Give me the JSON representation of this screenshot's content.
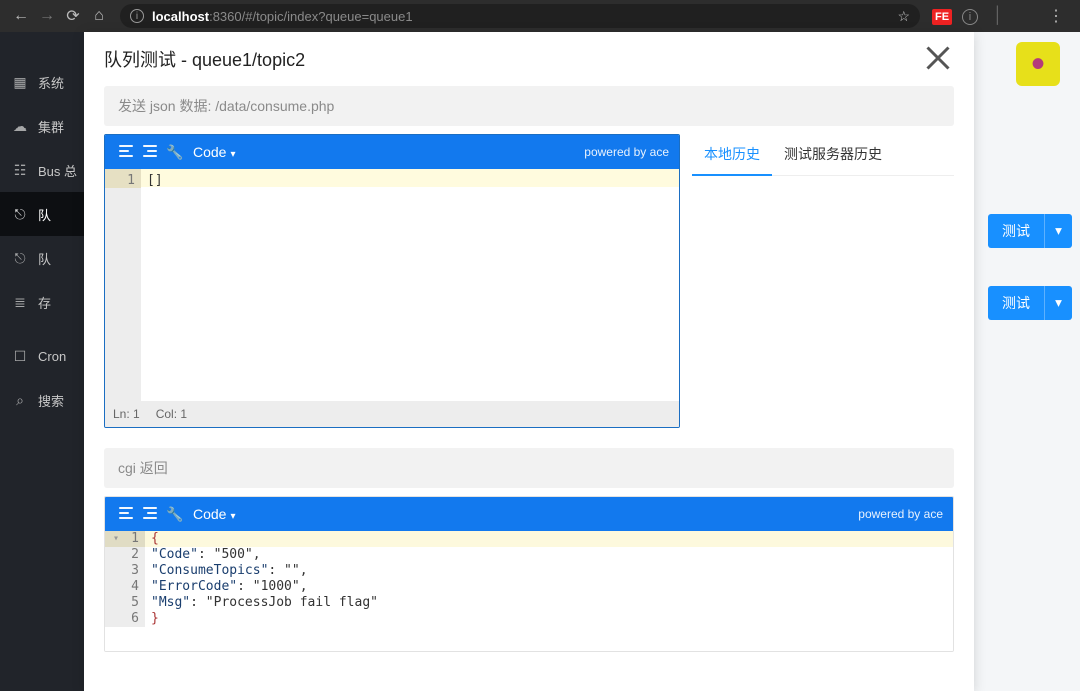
{
  "chrome": {
    "url_host": "localhost",
    "url_port": ":8360",
    "url_path": "/#/topic/index?queue=queue1",
    "ext_fe": "FE"
  },
  "sidebar": {
    "items": [
      {
        "icon": "grid",
        "label": "系统"
      },
      {
        "icon": "cluster",
        "label": "集群"
      },
      {
        "icon": "bus",
        "label": "Bus 总"
      },
      {
        "icon": "topic",
        "label": "队"
      },
      {
        "icon": "topic2",
        "label": "队"
      },
      {
        "icon": "db",
        "label": "存"
      },
      {
        "icon": "cron",
        "label": "Cron "
      },
      {
        "icon": "search",
        "label": "搜索"
      }
    ]
  },
  "row_buttons": {
    "label": "测试"
  },
  "modal": {
    "title": "队列测试 - queue1/topic2",
    "section1_head": "发送 json 数据: /data/consume.php",
    "toolbar": {
      "code_label": "Code",
      "powered": "powered by ace"
    },
    "editor1": {
      "line1_num": "1",
      "line1_text": "[]",
      "status_ln": "Ln: 1",
      "status_col": "Col: 1"
    },
    "tabs": {
      "local": "本地历史",
      "server": "测试服务器历史"
    },
    "section2_head": "cgi 返回",
    "editor2_lines": [
      {
        "n": "1",
        "txt": "{",
        "hl": true,
        "fold": true
      },
      {
        "n": "2",
        "txt": "    \"Code\": \"500\","
      },
      {
        "n": "3",
        "txt": "    \"ConsumeTopics\": \"\","
      },
      {
        "n": "4",
        "txt": "    \"ErrorCode\": \"1000\","
      },
      {
        "n": "5",
        "txt": "    \"Msg\": \"ProcessJob fail flag\""
      },
      {
        "n": "6",
        "txt": "}"
      }
    ]
  },
  "chart_data": {
    "type": "table",
    "title": "cgi response JSON",
    "columns": [
      "Code",
      "ConsumeTopics",
      "ErrorCode",
      "Msg"
    ],
    "rows": [
      [
        "500",
        "",
        "1000",
        "ProcessJob fail flag"
      ]
    ]
  }
}
